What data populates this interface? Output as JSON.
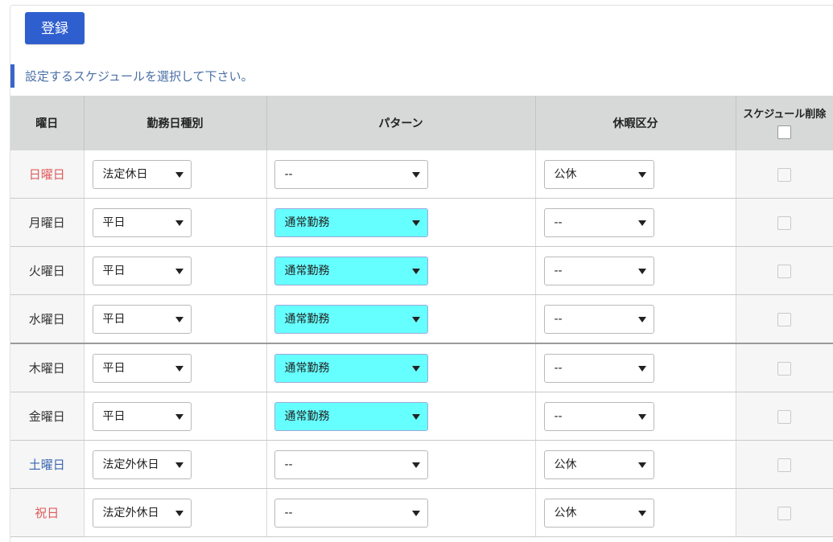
{
  "toolbar": {
    "register_label": "登録"
  },
  "instruction": "設定するスケジュールを選択して下さい。",
  "table": {
    "headers": {
      "day": "曜日",
      "work_type": "勤務日種別",
      "pattern": "パターン",
      "holiday": "休暇区分",
      "delete": "スケジュール削除"
    },
    "rows": [
      {
        "day": "日曜日",
        "work_type": "法定休日",
        "pattern": "--",
        "holiday": "公休",
        "day_color": "#e05a5a",
        "pattern_highlight": false
      },
      {
        "day": "月曜日",
        "work_type": "平日",
        "pattern": "通常勤務",
        "holiday": "--",
        "day_color": "#333333",
        "pattern_highlight": true
      },
      {
        "day": "火曜日",
        "work_type": "平日",
        "pattern": "通常勤務",
        "holiday": "--",
        "day_color": "#333333",
        "pattern_highlight": true
      },
      {
        "day": "水曜日",
        "work_type": "平日",
        "pattern": "通常勤務",
        "holiday": "--",
        "day_color": "#333333",
        "pattern_highlight": true
      },
      {
        "day": "木曜日",
        "work_type": "平日",
        "pattern": "通常勤務",
        "holiday": "--",
        "day_color": "#333333",
        "pattern_highlight": true
      },
      {
        "day": "金曜日",
        "work_type": "平日",
        "pattern": "通常勤務",
        "holiday": "--",
        "day_color": "#333333",
        "pattern_highlight": true
      },
      {
        "day": "土曜日",
        "work_type": "法定外休日",
        "pattern": "--",
        "holiday": "公休",
        "day_color": "#3a66b0",
        "pattern_highlight": false
      },
      {
        "day": "祝日",
        "work_type": "法定外休日",
        "pattern": "--",
        "holiday": "公休",
        "day_color": "#e05a5a",
        "pattern_highlight": false
      }
    ]
  },
  "colors": {
    "accent": "#2f5fcf",
    "pattern_highlight": "#66ffff",
    "header_bg": "#d7d8d8"
  }
}
